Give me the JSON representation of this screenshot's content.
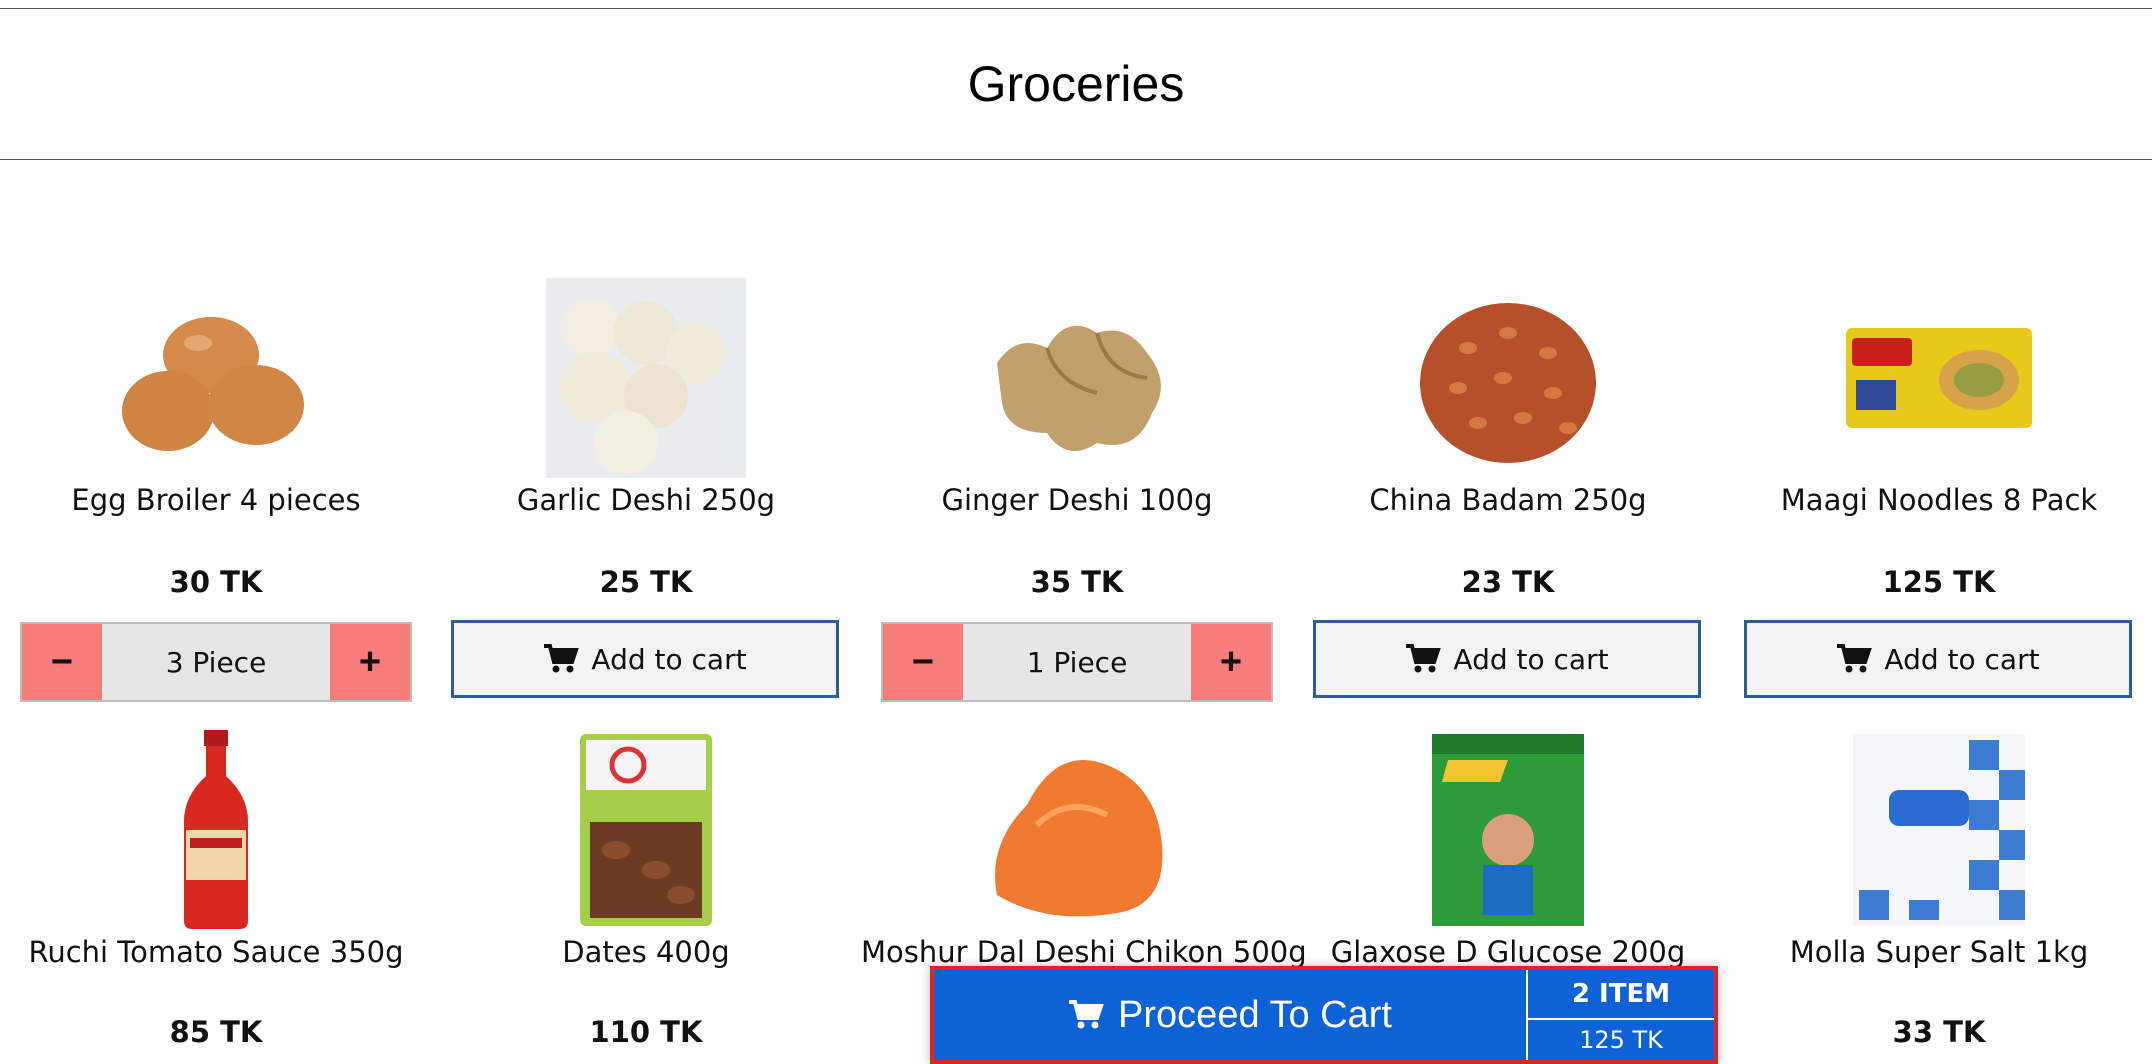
{
  "page": {
    "title": "Groceries"
  },
  "products": [
    {
      "name": "Egg Broiler 4 pieces",
      "price": "30 TK",
      "quantity": "3 Piece",
      "image": "eggs"
    },
    {
      "name": "Garlic Deshi 250g",
      "price": "25 TK",
      "action": "Add to cart",
      "image": "garlic"
    },
    {
      "name": "Ginger Deshi 100g",
      "price": "35 TK",
      "quantity": "1 Piece",
      "image": "ginger"
    },
    {
      "name": "China Badam 250g",
      "price": "23 TK",
      "action": "Add to cart",
      "image": "peanuts"
    },
    {
      "name": "Maagi Noodles 8 Pack",
      "price": "125 TK",
      "action": "Add to cart",
      "image": "noodles-pack"
    },
    {
      "name": "Ruchi Tomato Sauce 350g",
      "price": "85 TK",
      "image": "sauce-bottle"
    },
    {
      "name": "Dates 400g",
      "price": "110 TK",
      "image": "dates-pack"
    },
    {
      "name": "Moshur Dal Deshi Chikon 500g",
      "price": "",
      "image": "lentils"
    },
    {
      "name": "Glaxose D Glucose 200g",
      "price": "",
      "image": "glucose-box"
    },
    {
      "name": "Molla Super Salt 1kg",
      "price": "33 TK",
      "image": "salt-pack"
    }
  ],
  "controls": {
    "minus": "−",
    "plus": "+"
  },
  "cart": {
    "proceed_label": "Proceed To Cart",
    "item_count": "2 ITEM",
    "total": "125 TK"
  },
  "icons": {
    "cart": "cart-icon",
    "minus": "minus-icon",
    "plus": "plus-icon"
  },
  "colors": {
    "proceed_bg": "#0d62d6",
    "proceed_border": "#e02323",
    "qty_button": "#f77d7a",
    "add_border": "#2d5f97"
  }
}
